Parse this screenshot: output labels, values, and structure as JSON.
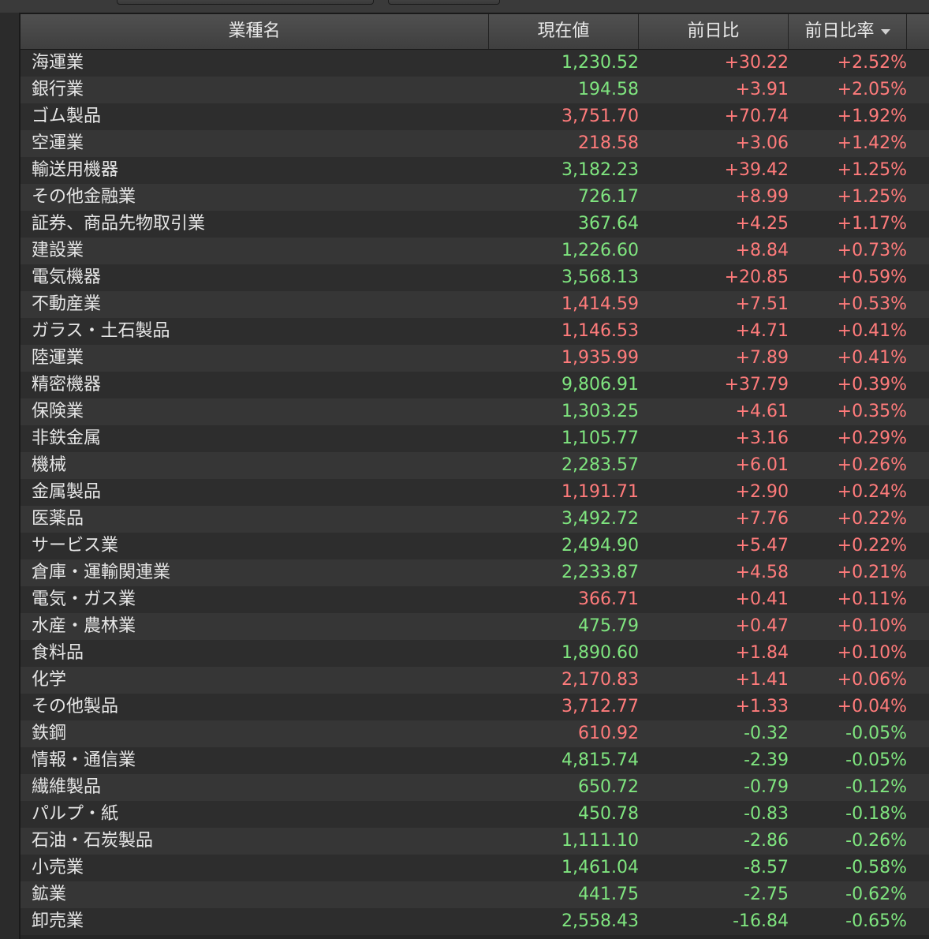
{
  "colors": {
    "positive": "#ff7b7b",
    "green": "#7fe57f"
  },
  "header": {
    "name": "業種名",
    "price": "現在値",
    "change": "前日比",
    "pct": "前日比率"
  },
  "rows": [
    {
      "name": "海運業",
      "price": "1,230.52",
      "change": "+30.22",
      "pct": "+2.52%",
      "price_color": "green",
      "change_color": "red"
    },
    {
      "name": "銀行業",
      "price": "194.58",
      "change": "+3.91",
      "pct": "+2.05%",
      "price_color": "green",
      "change_color": "red"
    },
    {
      "name": "ゴム製品",
      "price": "3,751.70",
      "change": "+70.74",
      "pct": "+1.92%",
      "price_color": "red",
      "change_color": "red"
    },
    {
      "name": "空運業",
      "price": "218.58",
      "change": "+3.06",
      "pct": "+1.42%",
      "price_color": "red",
      "change_color": "red"
    },
    {
      "name": "輸送用機器",
      "price": "3,182.23",
      "change": "+39.42",
      "pct": "+1.25%",
      "price_color": "green",
      "change_color": "red"
    },
    {
      "name": "その他金融業",
      "price": "726.17",
      "change": "+8.99",
      "pct": "+1.25%",
      "price_color": "green",
      "change_color": "red"
    },
    {
      "name": "証券、商品先物取引業",
      "price": "367.64",
      "change": "+4.25",
      "pct": "+1.17%",
      "price_color": "green",
      "change_color": "red"
    },
    {
      "name": "建設業",
      "price": "1,226.60",
      "change": "+8.84",
      "pct": "+0.73%",
      "price_color": "green",
      "change_color": "red"
    },
    {
      "name": "電気機器",
      "price": "3,568.13",
      "change": "+20.85",
      "pct": "+0.59%",
      "price_color": "green",
      "change_color": "red"
    },
    {
      "name": "不動産業",
      "price": "1,414.59",
      "change": "+7.51",
      "pct": "+0.53%",
      "price_color": "red",
      "change_color": "red"
    },
    {
      "name": "ガラス・土石製品",
      "price": "1,146.53",
      "change": "+4.71",
      "pct": "+0.41%",
      "price_color": "red",
      "change_color": "red"
    },
    {
      "name": "陸運業",
      "price": "1,935.99",
      "change": "+7.89",
      "pct": "+0.41%",
      "price_color": "red",
      "change_color": "red"
    },
    {
      "name": "精密機器",
      "price": "9,806.91",
      "change": "+37.79",
      "pct": "+0.39%",
      "price_color": "green",
      "change_color": "red"
    },
    {
      "name": "保険業",
      "price": "1,303.25",
      "change": "+4.61",
      "pct": "+0.35%",
      "price_color": "green",
      "change_color": "red"
    },
    {
      "name": "非鉄金属",
      "price": "1,105.77",
      "change": "+3.16",
      "pct": "+0.29%",
      "price_color": "green",
      "change_color": "red"
    },
    {
      "name": "機械",
      "price": "2,283.57",
      "change": "+6.01",
      "pct": "+0.26%",
      "price_color": "green",
      "change_color": "red"
    },
    {
      "name": "金属製品",
      "price": "1,191.71",
      "change": "+2.90",
      "pct": "+0.24%",
      "price_color": "red",
      "change_color": "red"
    },
    {
      "name": "医薬品",
      "price": "3,492.72",
      "change": "+7.76",
      "pct": "+0.22%",
      "price_color": "green",
      "change_color": "red"
    },
    {
      "name": "サービス業",
      "price": "2,494.90",
      "change": "+5.47",
      "pct": "+0.22%",
      "price_color": "green",
      "change_color": "red"
    },
    {
      "name": "倉庫・運輸関連業",
      "price": "2,233.87",
      "change": "+4.58",
      "pct": "+0.21%",
      "price_color": "green",
      "change_color": "red"
    },
    {
      "name": "電気・ガス業",
      "price": "366.71",
      "change": "+0.41",
      "pct": "+0.11%",
      "price_color": "red",
      "change_color": "red"
    },
    {
      "name": "水産・農林業",
      "price": "475.79",
      "change": "+0.47",
      "pct": "+0.10%",
      "price_color": "green",
      "change_color": "red"
    },
    {
      "name": "食料品",
      "price": "1,890.60",
      "change": "+1.84",
      "pct": "+0.10%",
      "price_color": "green",
      "change_color": "red"
    },
    {
      "name": "化学",
      "price": "2,170.83",
      "change": "+1.41",
      "pct": "+0.06%",
      "price_color": "red",
      "change_color": "red"
    },
    {
      "name": "その他製品",
      "price": "3,712.77",
      "change": "+1.33",
      "pct": "+0.04%",
      "price_color": "red",
      "change_color": "red"
    },
    {
      "name": "鉄鋼",
      "price": "610.92",
      "change": "-0.32",
      "pct": "-0.05%",
      "price_color": "red",
      "change_color": "green"
    },
    {
      "name": "情報・通信業",
      "price": "4,815.74",
      "change": "-2.39",
      "pct": "-0.05%",
      "price_color": "green",
      "change_color": "green"
    },
    {
      "name": "繊維製品",
      "price": "650.72",
      "change": "-0.79",
      "pct": "-0.12%",
      "price_color": "green",
      "change_color": "green"
    },
    {
      "name": "パルプ・紙",
      "price": "450.78",
      "change": "-0.83",
      "pct": "-0.18%",
      "price_color": "green",
      "change_color": "green"
    },
    {
      "name": "石油・石炭製品",
      "price": "1,111.10",
      "change": "-2.86",
      "pct": "-0.26%",
      "price_color": "green",
      "change_color": "green"
    },
    {
      "name": "小売業",
      "price": "1,461.04",
      "change": "-8.57",
      "pct": "-0.58%",
      "price_color": "green",
      "change_color": "green"
    },
    {
      "name": "鉱業",
      "price": "441.75",
      "change": "-2.75",
      "pct": "-0.62%",
      "price_color": "green",
      "change_color": "green"
    },
    {
      "name": "卸売業",
      "price": "2,558.43",
      "change": "-16.84",
      "pct": "-0.65%",
      "price_color": "green",
      "change_color": "green"
    }
  ]
}
